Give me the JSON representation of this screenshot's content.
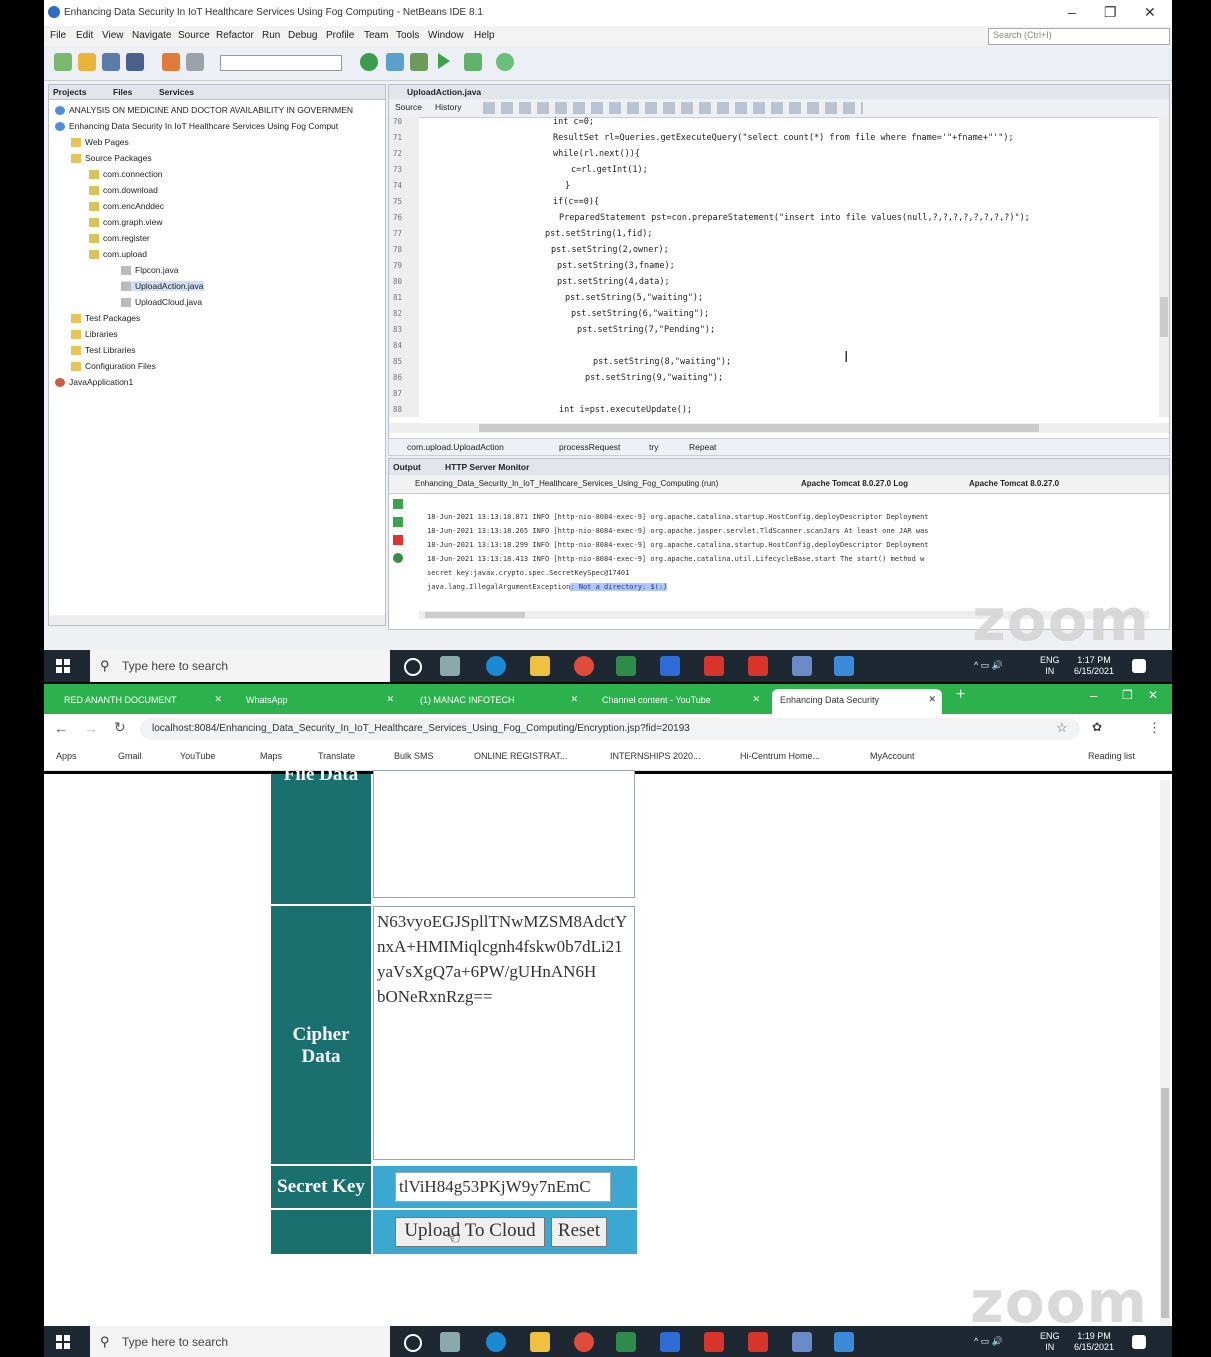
{
  "netbeans": {
    "title": "Enhancing Data Security In IoT Healthcare Services Using Fog Computing - NetBeans IDE 8.1",
    "menu": [
      "File",
      "Edit",
      "View",
      "Navigate",
      "Source",
      "Refactor",
      "Run",
      "Debug",
      "Profile",
      "Team",
      "Tools",
      "Window",
      "Help"
    ],
    "search_placeholder": "Search (Ctrl+I)",
    "panel_tabs": [
      "Projects",
      "Files",
      "Services"
    ],
    "tree": [
      "ANALYSIS ON MEDICINE AND DOCTOR AVAILABILITY IN GOVERNMEN",
      "Enhancing Data Security In IoT Healthcare Services Using Fog Comput",
      "Web Pages",
      "Source Packages",
      "com.connection",
      "com.download",
      "com.encAnddec",
      "com.graph.view",
      "com.register",
      "com.upload",
      "Flpcon.java",
      "UploadAction.java",
      "UploadCloud.java",
      "Test Packages",
      "Libraries",
      "Test Libraries",
      "Configuration Files",
      "JavaApplication1"
    ],
    "editor_tab": "UploadAction.java",
    "editor_buttons": [
      "Source",
      "History"
    ],
    "line_numbers": [
      "70",
      "71",
      "72",
      "73",
      "74",
      "75",
      "76",
      "77",
      "78",
      "79",
      "80",
      "81",
      "82",
      "83",
      "84",
      "85",
      "86",
      "87",
      "88"
    ],
    "code": [
      "int c=0;",
      "ResultSet rl=Queries.getExecuteQuery(\"select count(*) from file where fname='\"+fname+\"'\");",
      "while(rl.next()){",
      "c=rl.getInt(1);",
      "}",
      "if(c==0){",
      "PreparedStatement pst=con.prepareStatement(\"insert into file values(null,?,?,?,?,?,?,?,?)\");",
      "pst.setString(1,fid);",
      "pst.setString(2,owner);",
      "pst.setString(3,fname);",
      "pst.setString(4,data);",
      "pst.setString(5,\"waiting\");",
      "pst.setString(6,\"waiting\");",
      "pst.setString(7,\"Pending\");",
      "",
      "pst.setString(8,\"waiting\");",
      "pst.setString(9,\"waiting\");",
      "",
      "int i=pst.executeUpdate();"
    ],
    "breadcrumb": [
      "com.upload.UploadAction",
      "processRequest",
      "try",
      "Repeat"
    ],
    "output_tabs": [
      "Output",
      "HTTP Server Monitor"
    ],
    "output_subtabs": [
      "Enhancing_Data_Security_In_IoT_Healthcare_Services_Using_Fog_Computing (run)",
      "Apache Tomcat 8.0.27.0 Log",
      "Apache Tomcat 8.0.27.0"
    ],
    "log": [
      "18-Jun-2021 13:13:18.871 INFO [http-nio-8084-exec-9] org.apache.catalina.startup.HostConfig.deployDescriptor Deployment",
      "18-Jun-2021 13:13:18.265 INFO [http-nio-8084-exec-9] org.apache.jasper.servlet.TldScanner.scanJars At least one JAR was",
      "18-Jun-2021 13:13:18.299 INFO [http-nio-8084-exec-9] org.apache.catalina.startup.HostConfig.deployDescriptor Deployment",
      "18-Jun-2021 13:13:18.413 INFO [http-nio-8084-exec-9] org.apache.catalina.util.LifecycleBase.start The start() method w",
      "secret key:javax.crypto.spec.SecretKeySpec@17401"
    ],
    "log_exception_prefix": "java.lang.IllegalArgumentException",
    "log_exception_suffix": ": Not a directory: $(:)"
  },
  "taskbar_top": {
    "search": "Type here to search",
    "lang": "ENG",
    "region": "IN",
    "time": "1:17 PM",
    "date": "6/15/2021"
  },
  "taskbar_bottom": {
    "search": "Type here to search",
    "lang": "ENG",
    "region": "IN",
    "time": "1:19 PM",
    "date": "6/15/2021"
  },
  "watermark": "zoom",
  "chrome": {
    "tabs": [
      "RED ANANTH DOCUMENT",
      "WhatsApp",
      "(1) MANAC INFOTECH",
      "Channel content - YouTube",
      "Enhancing Data Security"
    ],
    "url": "localhost:8084/Enhancing_Data_Security_In_IoT_Healthcare_Services_Using_Fog_Computing/Encryption.jsp?fid=20193",
    "bookmarks": [
      "Apps",
      "Gmail",
      "YouTube",
      "Maps",
      "Translate",
      "Bulk SMS",
      "ONLINE REGISTRAT...",
      "INTERNSHIPS 2020...",
      "Hi-Centrum Home...",
      "MyAccount",
      "Reading list"
    ]
  },
  "form": {
    "file_data_label": "File Data",
    "cipher_data_label": "Cipher Data",
    "cipher_value": "N63vyoEGJSpllTNwMZSM8AdctYnxA+HMIMiqlcgnh4fskw0b7dLi21yaVsXgQ7a+6PW/gUHnAN6H\nbONeRxnRzg==",
    "secret_key_label": "Secret Key",
    "secret_key_value": "tlViH84g53PKjW9y7nEmC",
    "upload_button": "Upload To Cloud",
    "reset_button": "Reset"
  }
}
